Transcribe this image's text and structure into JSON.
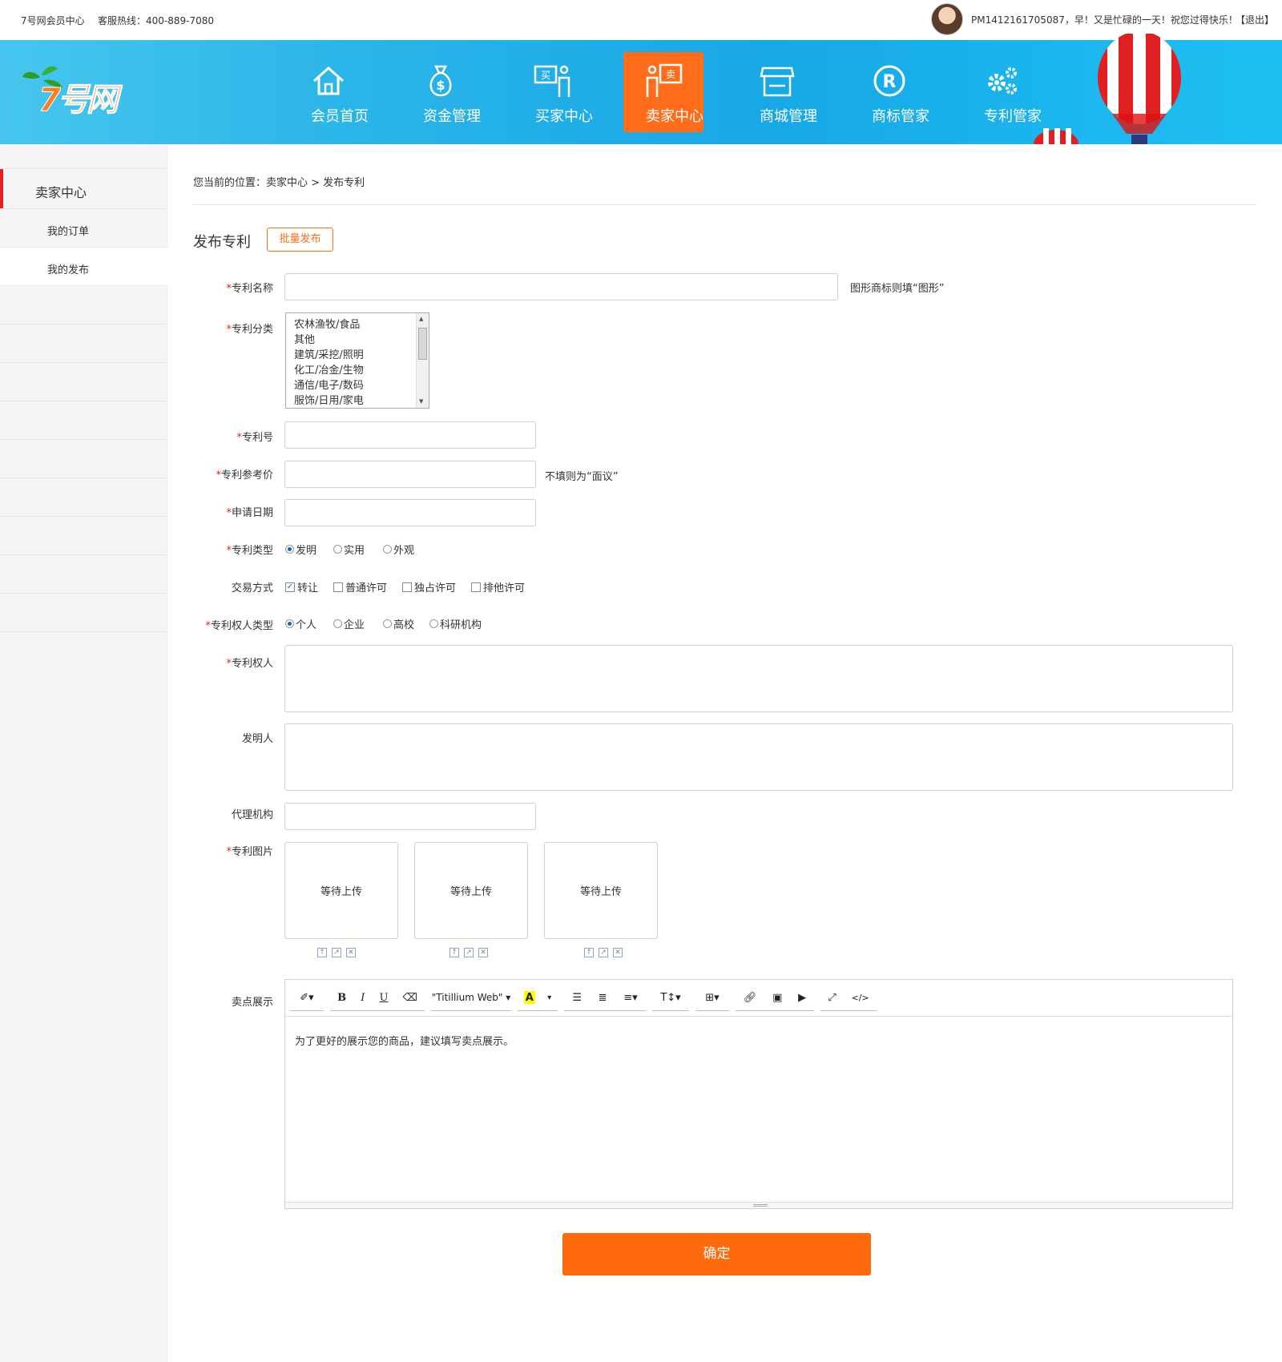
{
  "topbar": {
    "site_name": "7号网会员中心",
    "hotline": "客服热线：400-889-7080",
    "greeting": "PM1412161705087，早！又是忙碌的一天！祝您过得快乐！",
    "logout": "【退出】"
  },
  "header": {
    "logo_text": "7号网",
    "nav": [
      {
        "label": "会员首页",
        "icon": "home-icon"
      },
      {
        "label": "资金管理",
        "icon": "money-bag-icon"
      },
      {
        "label": "买家中心",
        "icon": "buyer-icon",
        "icon_char": "买"
      },
      {
        "label": "卖家中心",
        "icon": "seller-icon",
        "icon_char": "卖",
        "active": true
      },
      {
        "label": "商城管理",
        "icon": "store-icon"
      },
      {
        "label": "商标管家",
        "icon": "registered-trademark-icon"
      },
      {
        "label": "专利管家",
        "icon": "gears-icon"
      }
    ],
    "accent_color": "#ff6d1a",
    "bg_color": "#1aa9e6"
  },
  "sidebar": {
    "title": "卖家中心",
    "items": [
      "我的订单",
      "我的发布"
    ]
  },
  "breadcrumb": "您当前的位置：卖家中心 > 发布专利",
  "page": {
    "title": "发布专利",
    "batch_button": "批量发布"
  },
  "form": {
    "required_mark": "*",
    "name_label": "专利名称",
    "name_value": "",
    "name_hint": "图形商标则填“图形”",
    "category_label": "专利分类",
    "category_options": [
      "农林渔牧/食品",
      "其他",
      "建筑/采挖/照明",
      "化工/冶金/生物",
      "通信/电子/数码",
      "服饰/日用/家电"
    ],
    "number_label": "专利号",
    "price_label": "专利参考价",
    "price_hint": "不填则为“面议”",
    "date_label": "申请日期",
    "type_label": "专利类型",
    "type_options": [
      "发明",
      "实用",
      "外观"
    ],
    "type_selected": "发明",
    "trade_label": "交易方式",
    "trade_options": [
      "转让",
      "普通许可",
      "独占许可",
      "排他许可"
    ],
    "trade_checked": [
      "转让"
    ],
    "owner_type_label": "专利权人类型",
    "owner_type_options": [
      "个人",
      "企业",
      "高校",
      "科研机构"
    ],
    "owner_type_selected": "个人",
    "owner_label": "专利权人",
    "inventor_label": "发明人",
    "agency_label": "代理机构",
    "image_label": "专利图片",
    "upload_text": "等待上传",
    "selling_label": "卖点展示",
    "editor_font": "\"Titillium Web\"",
    "editor_placeholder": "为了更好的展示您的商品，建议填写卖点展示。",
    "submit": "确定",
    "submit_color": "#ff6a0c"
  }
}
